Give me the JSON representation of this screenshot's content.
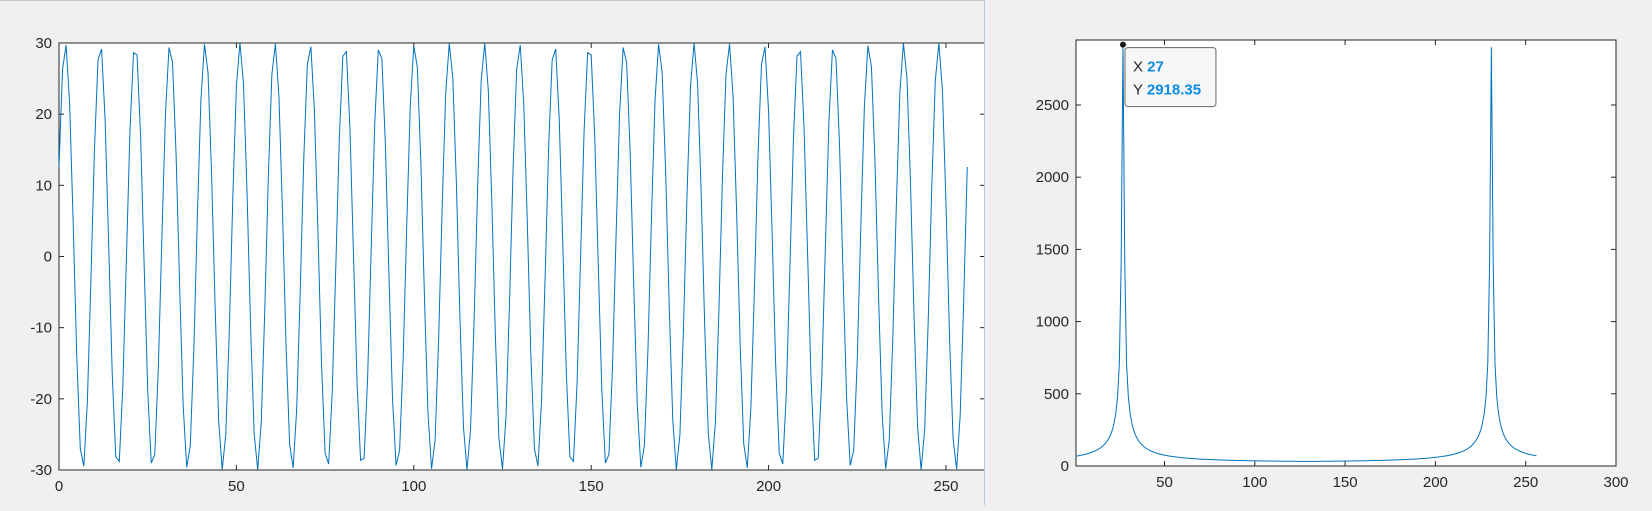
{
  "chart_data": [
    {
      "type": "line",
      "title": "",
      "xlabel": "",
      "ylabel": "",
      "xlim": [
        0,
        261
      ],
      "ylim": [
        -30,
        30
      ],
      "xticks": [
        0,
        50,
        100,
        150,
        200,
        250
      ],
      "yticks": [
        -30,
        -20,
        -10,
        0,
        10,
        20,
        30
      ],
      "series": [
        {
          "color": "#0072bd",
          "function": "30*cos(2*pi*26*(x-1)/256 - 0.5)",
          "x_start": 0,
          "x_end": 256,
          "x_step": 1,
          "note_values": "sinusoid amplitude 30, 26 cycles over 256 samples"
        }
      ],
      "grid": false
    },
    {
      "type": "line",
      "title": "",
      "xlabel": "",
      "ylabel": "",
      "xlim": [
        1,
        300
      ],
      "ylim": [
        0,
        2950
      ],
      "xticks": [
        50,
        100,
        150,
        200,
        250,
        300
      ],
      "yticks": [
        0,
        500,
        1000,
        1500,
        2000,
        2500
      ],
      "series": [
        {
          "color": "#0072bd",
          "peaks": [
            {
              "x": 27,
              "y": 2918.35
            },
            {
              "x": 231,
              "y": 2900
            }
          ],
          "x_start": 1,
          "x_end": 256,
          "baseline_min": 27
        }
      ],
      "datatip": {
        "x_label": "X",
        "x_value": "27",
        "y_label": "Y",
        "y_value": "2918.35"
      },
      "grid": false
    }
  ]
}
